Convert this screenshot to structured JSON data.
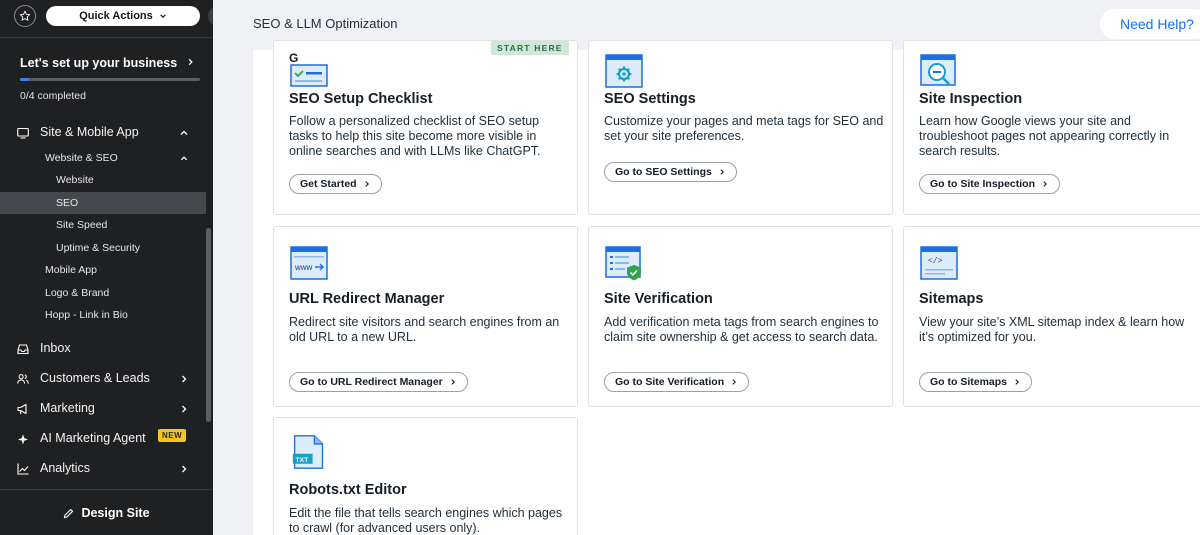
{
  "sidebar": {
    "quick_actions": "Quick Actions",
    "setup": {
      "title": "Let's set up your business",
      "progress_text": "0/4 completed",
      "progress": 0.05
    },
    "nav": {
      "site_mobile_app": "Site & Mobile App",
      "website_seo": "Website & SEO",
      "website": "Website",
      "seo": "SEO",
      "site_speed": "Site Speed",
      "uptime_security": "Uptime & Security",
      "mobile_app": "Mobile App",
      "logo_brand": "Logo & Brand",
      "hopp": "Hopp - Link in Bio",
      "inbox": "Inbox",
      "customers_leads": "Customers & Leads",
      "marketing": "Marketing",
      "ai_marketing_agent": "AI Marketing Agent",
      "new_badge": "NEW",
      "analytics": "Analytics"
    },
    "design_site": "Design Site"
  },
  "header": {
    "title": "SEO & LLM Optimization",
    "need_help": "Need Help?"
  },
  "cards": {
    "seo_setup": {
      "badge": "START HERE",
      "title": "SEO Setup Checklist",
      "description": "Follow a personalized checklist of SEO setup tasks to help this site become more visible in online searches and with LLMs like ChatGPT.",
      "button": "Get Started"
    },
    "seo_settings": {
      "title": "SEO Settings",
      "description": "Customize your pages and meta tags for SEO and set your site preferences.",
      "button": "Go to SEO Settings"
    },
    "site_inspection": {
      "title": "Site Inspection",
      "description": "Learn how Google views your site and troubleshoot pages not appearing correctly in search results.",
      "button": "Go to Site Inspection"
    },
    "url_redirect": {
      "icon_text": "www",
      "title": "URL Redirect Manager",
      "description": "Redirect site visitors and search engines from an old URL to a new URL.",
      "button": "Go to URL Redirect Manager"
    },
    "site_verification": {
      "title": "Site Verification",
      "description": "Add verification meta tags from search engines to claim site ownership & get access to search data.",
      "button": "Go to Site Verification"
    },
    "sitemaps": {
      "icon_text": "</>",
      "title": "Sitemaps",
      "description": "View your site’s XML sitemap index & learn how it’s optimized for you.",
      "button": "Go to Sitemaps"
    },
    "robots": {
      "icon_text": "TXT",
      "title": "Robots.txt Editor",
      "description": "Edit the file that tells search engines which pages to crawl (for advanced users only)."
    }
  },
  "colors": {
    "accent": "#116dff",
    "sidebar_bg": "#1f2022",
    "badge_yellow": "#f7c51d",
    "start_here_bg": "#cfe7d6"
  },
  "icons": [
    "star-icon",
    "chevron-down-icon",
    "chevron-right-icon",
    "chevron-left-icon",
    "site-icon",
    "inbox-icon",
    "customers-icon",
    "marketing-icon",
    "ai-sparkle-icon",
    "analytics-icon",
    "pencil-icon"
  ]
}
